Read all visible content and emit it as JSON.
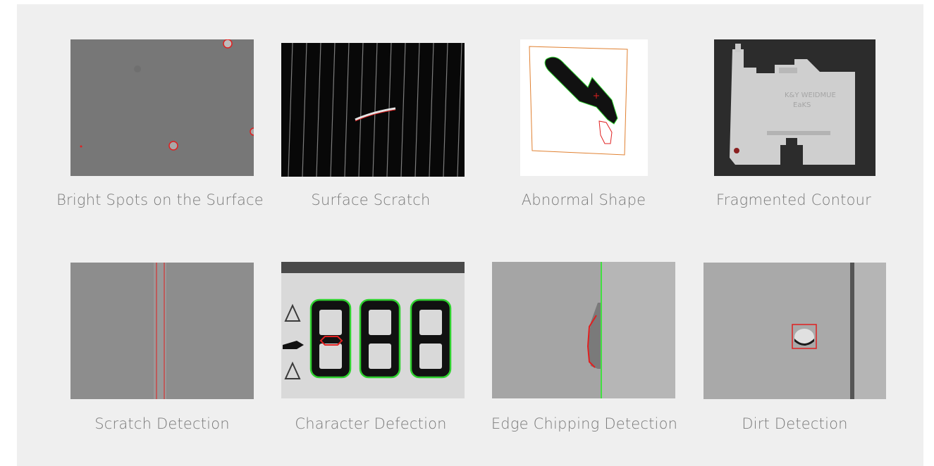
{
  "gallery": {
    "items": [
      {
        "caption": "Bright Spots on the Surface",
        "image": "bright-spots-photo"
      },
      {
        "caption": "Surface Scratch",
        "image": "surface-scratch-photo"
      },
      {
        "caption": "Abnormal Shape",
        "image": "abnormal-shape-photo"
      },
      {
        "caption": "Fragmented Contour",
        "image": "fragmented-contour-photo"
      },
      {
        "caption": "Scratch Detection",
        "image": "scratch-detection-photo"
      },
      {
        "caption": "Character Defection",
        "image": "character-defection-photo"
      },
      {
        "caption": "Edge Chipping Detection",
        "image": "edge-chipping-photo"
      },
      {
        "caption": "Dirt Detection",
        "image": "dirt-detection-photo"
      }
    ],
    "colors": {
      "background": "#efefef",
      "caption": "#7a7a7a",
      "defect_marker": "#e02020",
      "match_outline": "#2fd12f"
    }
  }
}
